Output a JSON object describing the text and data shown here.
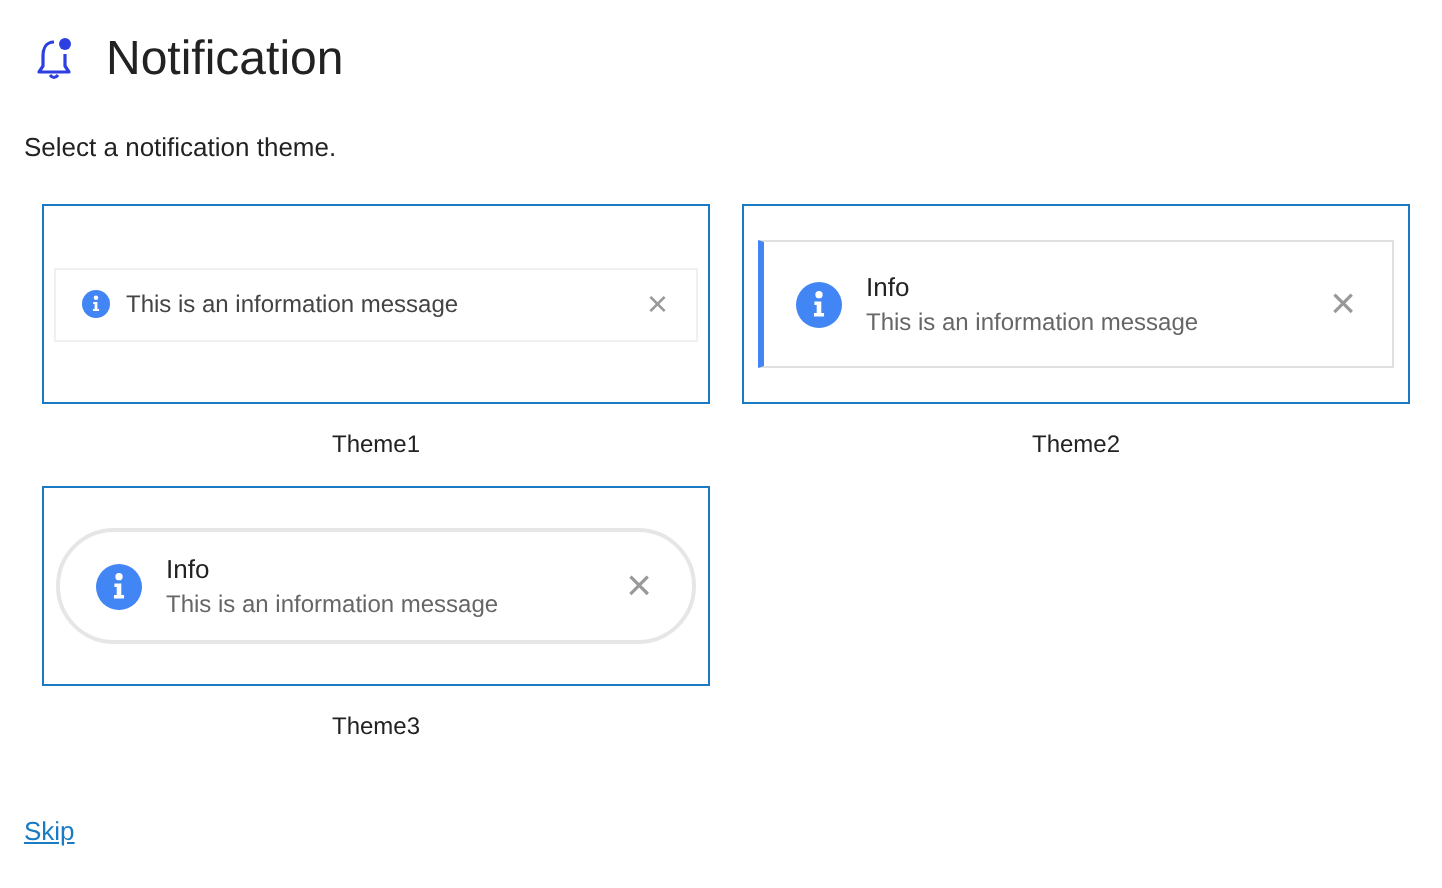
{
  "header": {
    "title": "Notification"
  },
  "instruction": "Select a notification theme.",
  "themes": [
    {
      "kind": "plain",
      "message": "This is an information message",
      "close": "×",
      "label": "Theme1"
    },
    {
      "kind": "accent",
      "title": "Info",
      "message": "This is an information message",
      "close": "×",
      "label": "Theme2"
    },
    {
      "kind": "pill",
      "title": "Info",
      "message": "This is an information message",
      "close": "×",
      "label": "Theme3"
    }
  ],
  "skip_link": "Skip"
}
